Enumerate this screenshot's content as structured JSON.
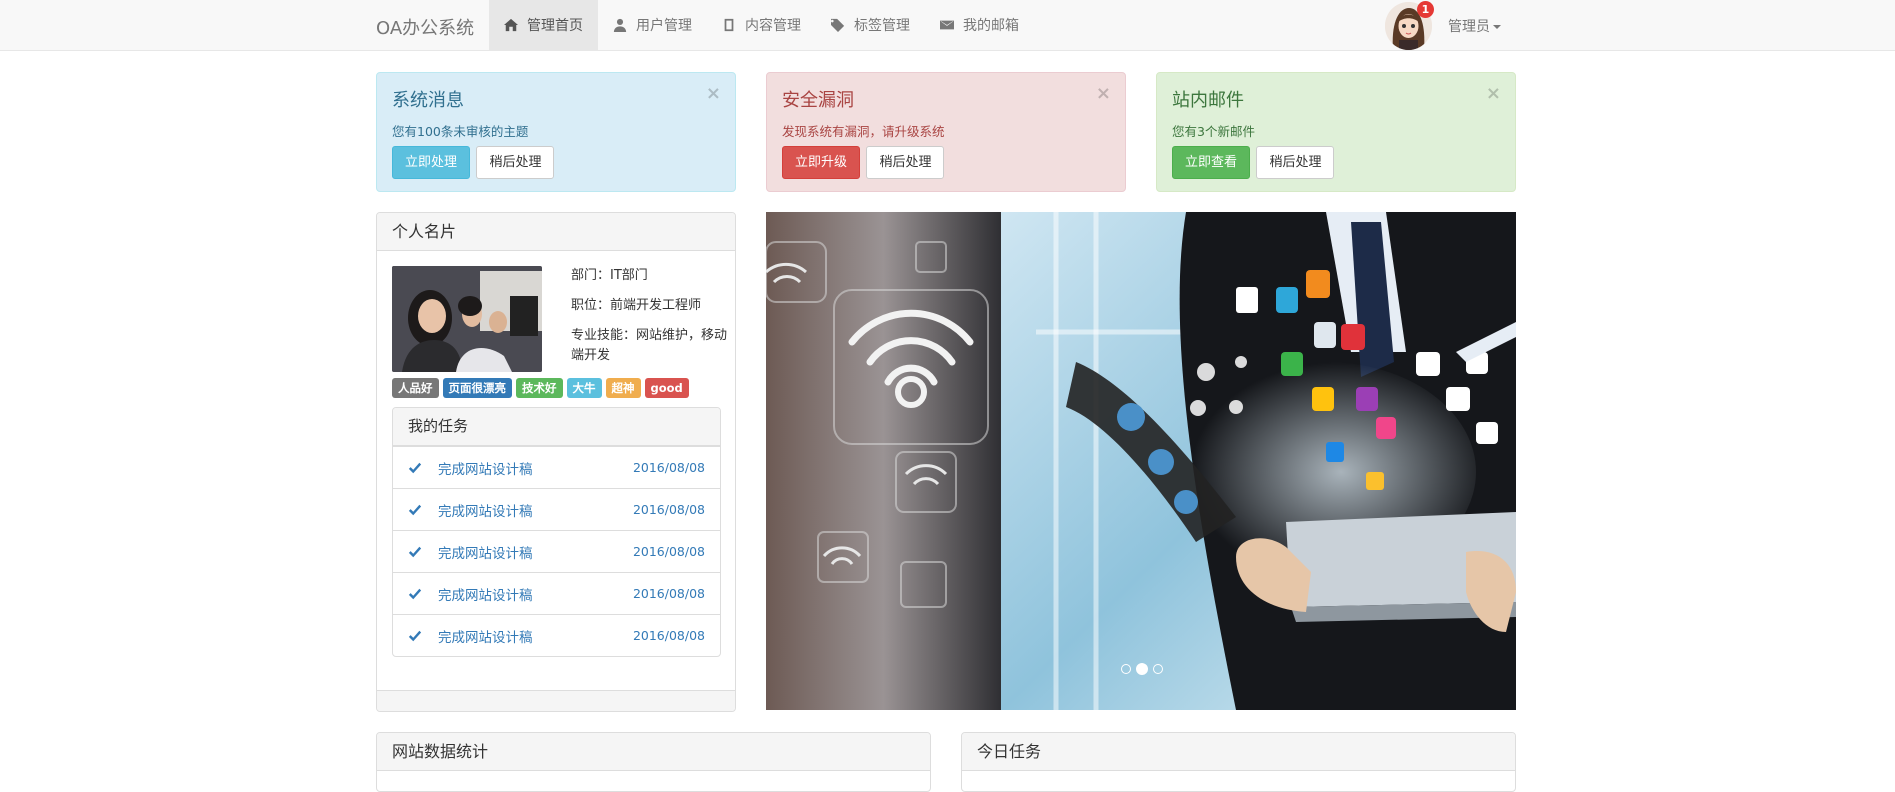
{
  "navbar": {
    "brand": "OA办公系统",
    "items": [
      {
        "label": "管理首页",
        "icon": "home-icon",
        "active": true
      },
      {
        "label": "用户管理",
        "icon": "user-icon",
        "active": false
      },
      {
        "label": "内容管理",
        "icon": "book-icon",
        "active": false
      },
      {
        "label": "标签管理",
        "icon": "tags-icon",
        "active": false
      },
      {
        "label": "我的邮箱",
        "icon": "envelope-icon",
        "active": false
      }
    ],
    "notification_count": "1",
    "user": "管理员"
  },
  "alerts": [
    {
      "title": "系统消息",
      "text": "您有100条未审核的主题",
      "primary": "立即处理",
      "secondary": "稍后处理",
      "color": "#5bc0de"
    },
    {
      "title": "安全漏洞",
      "text": "发现系统有漏洞，请升级系统",
      "primary": "立即升级",
      "secondary": "稍后处理",
      "color": "#d9534f"
    },
    {
      "title": "站内邮件",
      "text": "您有3个新邮件",
      "primary": "立即查看",
      "secondary": "稍后处理",
      "color": "#5cb85c"
    }
  ],
  "profile": {
    "title": "个人名片",
    "department": "部门：IT部门",
    "position": "职位：前端开发工程师",
    "skills": "专业技能：网站维护，移动端开发",
    "labels": [
      {
        "text": "人品好",
        "color": "#777777"
      },
      {
        "text": "页面很漂亮",
        "color": "#337ab7"
      },
      {
        "text": "技术好",
        "color": "#5cb85c"
      },
      {
        "text": "大牛",
        "color": "#5bc0de"
      },
      {
        "text": "超神",
        "color": "#f0ad4e"
      },
      {
        "text": "good",
        "color": "#d9534f"
      }
    ]
  },
  "tasks": {
    "title": "我的任务",
    "items": [
      {
        "text": "完成网站设计稿",
        "date": "2016/08/08"
      },
      {
        "text": "完成网站设计稿",
        "date": "2016/08/08"
      },
      {
        "text": "完成网站设计稿",
        "date": "2016/08/08"
      },
      {
        "text": "完成网站设计稿",
        "date": "2016/08/08"
      },
      {
        "text": "完成网站设计稿",
        "date": "2016/08/08"
      }
    ]
  },
  "carousel": {
    "slides": 3,
    "active": 1
  },
  "panels": {
    "stats": "网站数据统计",
    "today": "今日任务"
  }
}
